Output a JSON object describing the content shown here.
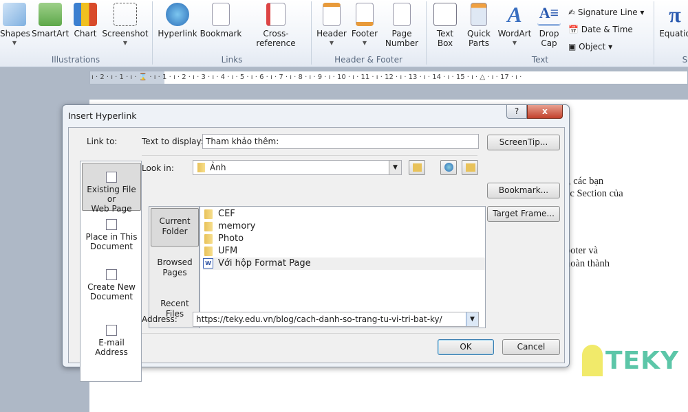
{
  "ribbon": {
    "illustrations": {
      "group": "Illustrations",
      "items": [
        {
          "label": "Shapes",
          "dropdown": true
        },
        {
          "label": "SmartArt"
        },
        {
          "label": "Chart"
        },
        {
          "label": "Screenshot",
          "dropdown": true
        }
      ]
    },
    "links": {
      "group": "Links",
      "items": [
        {
          "label": "Hyperlink"
        },
        {
          "label": "Bookmark"
        },
        {
          "label": "Cross-reference"
        }
      ]
    },
    "header_footer": {
      "group": "Header & Footer",
      "items": [
        {
          "label": "Header"
        },
        {
          "label": "Footer"
        },
        {
          "label1": "Page",
          "label2": "Number"
        }
      ]
    },
    "text": {
      "group": "Text",
      "items": [
        {
          "label1": "Text",
          "label2": "Box"
        },
        {
          "label1": "Quick",
          "label2": "Parts"
        },
        {
          "label": "WordArt"
        },
        {
          "label1": "Drop",
          "label2": "Cap"
        }
      ],
      "small": [
        "Signature Line",
        "Date & Time",
        "Object"
      ]
    },
    "symbols": {
      "group": "Sy",
      "equation": "Equatio",
      "glyph": "π"
    }
  },
  "ruler": "ı · 2 · ı · 1 · ı · ⌛ · ı · 1 · ı · 2 · ı · 3 · ı · 4 · ı · 5 · ı · 6 · ı · 7 · ı · 8 · ı · 9 · ı · 10 · ı · 11 · ı · 12 · ı · 13 · ı · 14 · ı · 15 · ı · △ · ı · 17 · ı ·",
  "document": {
    "lines": [
      "t, các bạn",
      "ác Section của",
      "ooter và",
      "hoàn thành"
    ]
  },
  "dialog": {
    "title": "Insert Hyperlink",
    "help": "?",
    "close": "x",
    "link_to_label": "Link to:",
    "link_to": [
      {
        "l1": "Existing File or",
        "l2": "Web Page",
        "selected": true
      },
      {
        "l1": "Place in This",
        "l2": "Document"
      },
      {
        "l1": "Create New",
        "l2": "Document"
      },
      {
        "l1": "E-mail Address",
        "l2": ""
      }
    ],
    "text_to_display_label": "Text to display:",
    "text_to_display": "Tham khảo thêm:",
    "screentip": "ScreenTip...",
    "look_in_label": "Look in:",
    "look_in": "Ảnh",
    "nav": [
      {
        "l1": "Current",
        "l2": "Folder",
        "selected": true
      },
      {
        "l1": "Browsed",
        "l2": "Pages"
      },
      {
        "l1": "Recent",
        "l2": "Files"
      }
    ],
    "files": [
      {
        "name": "CEF",
        "type": "folder"
      },
      {
        "name": "memory",
        "type": "folder"
      },
      {
        "name": "Photo",
        "type": "folder"
      },
      {
        "name": "UFM",
        "type": "folder"
      },
      {
        "name": "Với hộp Format Page",
        "type": "word"
      }
    ],
    "bookmark": "Bookmark...",
    "target_frame": "Target Frame...",
    "address_label": "Address:",
    "address": "https://teky.edu.vn/blog/cach-danh-so-trang-tu-vi-tri-bat-ky/",
    "ok": "OK",
    "cancel": "Cancel"
  },
  "watermark": {
    "text": "TEKY",
    "color": "#5cc6a8"
  }
}
